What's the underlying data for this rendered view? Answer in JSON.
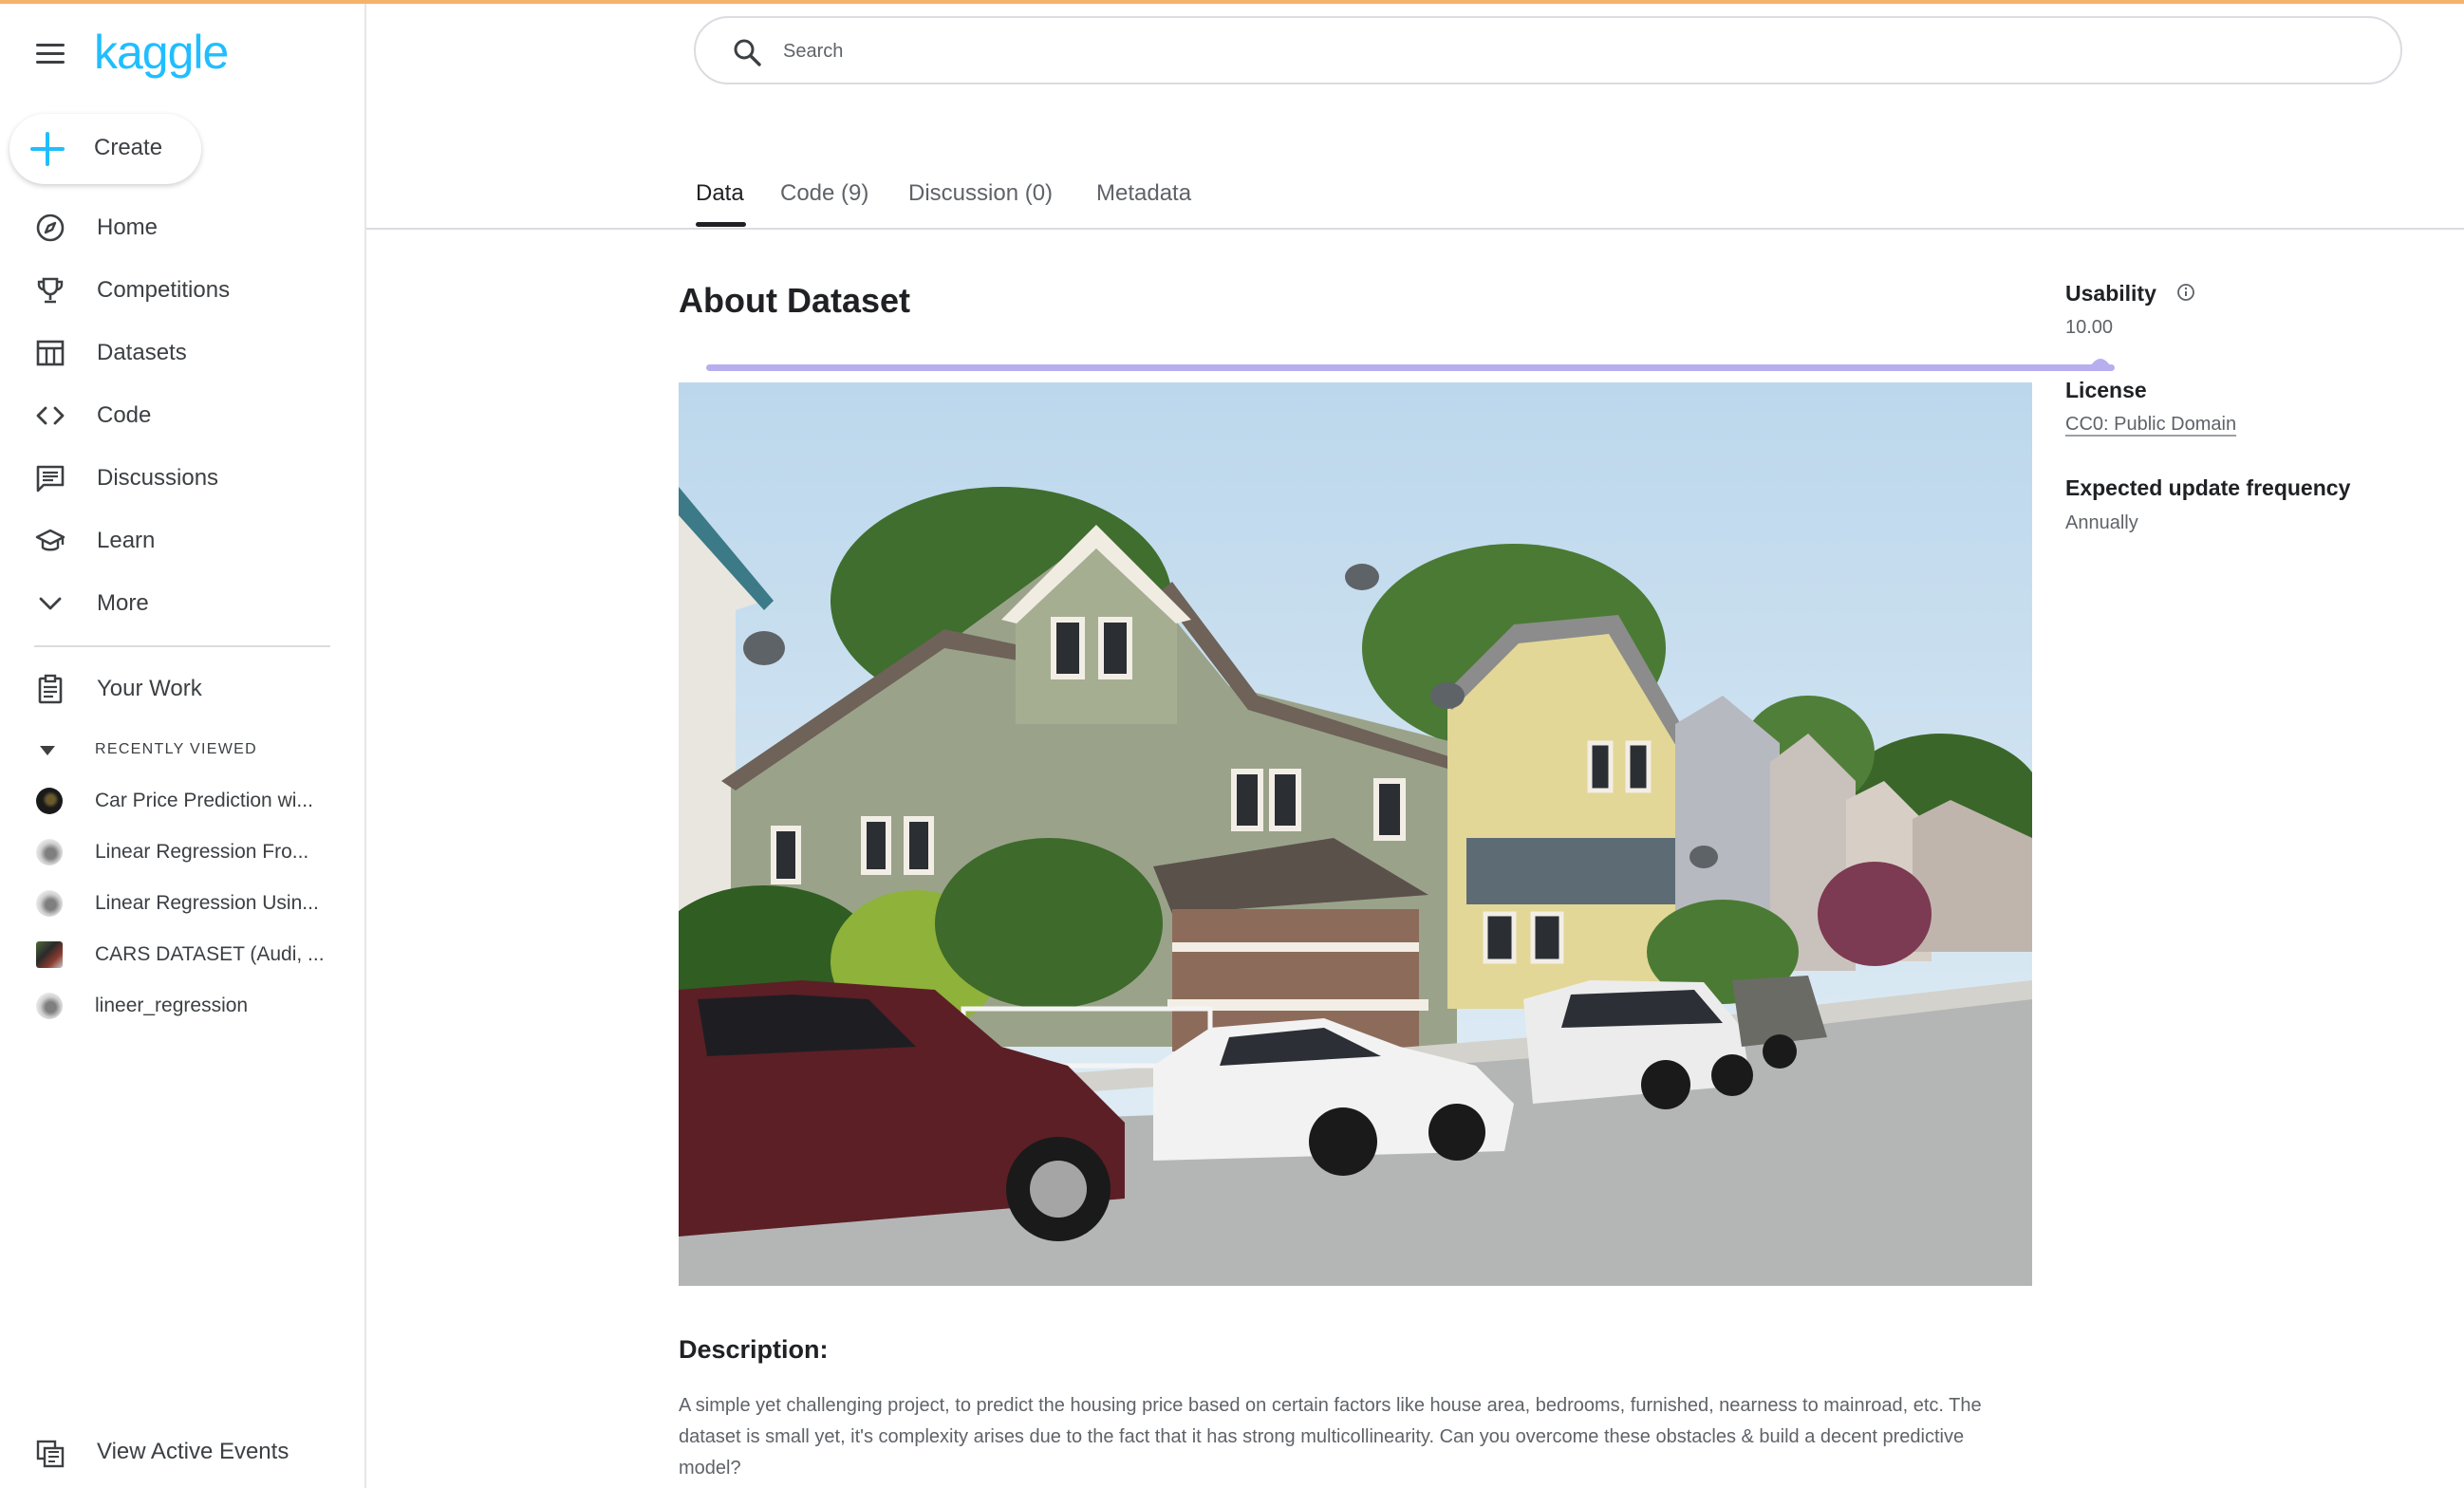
{
  "brand": {
    "logo_text": "kaggle",
    "accent_color": "#20beff",
    "top_bar_color": "#f4b26a"
  },
  "sidebar": {
    "create_label": "Create",
    "nav": [
      {
        "label": "Home",
        "icon": "compass-icon"
      },
      {
        "label": "Competitions",
        "icon": "trophy-icon"
      },
      {
        "label": "Datasets",
        "icon": "table-icon"
      },
      {
        "label": "Code",
        "icon": "code-brackets-icon"
      },
      {
        "label": "Discussions",
        "icon": "comment-icon"
      },
      {
        "label": "Learn",
        "icon": "graduation-cap-icon"
      },
      {
        "label": "More",
        "icon": "chevron-down-icon"
      }
    ],
    "your_work": {
      "label": "Your Work",
      "icon": "clipboard-icon"
    },
    "recently_viewed_heading": "RECENTLY VIEWED",
    "recently_viewed": [
      {
        "label": "Car Price Prediction wi..."
      },
      {
        "label": "Linear Regression Fro..."
      },
      {
        "label": "Linear Regression Usin..."
      },
      {
        "label": "CARS DATASET (Audi, ..."
      },
      {
        "label": "lineer_regression"
      }
    ],
    "events_label": "View Active Events"
  },
  "search": {
    "placeholder": "Search"
  },
  "tabs": [
    {
      "label": "Data",
      "active": true
    },
    {
      "label": "Code (9)",
      "active": false
    },
    {
      "label": "Discussion (0)",
      "active": false
    },
    {
      "label": "Metadata",
      "active": false
    }
  ],
  "main": {
    "title": "About Dataset",
    "usability_bar_color": "#b7aef0",
    "description_heading": "Description:",
    "description_text": "A simple yet challenging project, to predict the housing price based on certain factors like house area, bedrooms, furnished, nearness to mainroad, etc. The dataset is small yet, it's complexity arises due to the fact that it has strong multicollinearity. Can you overcome these obstacles & build a decent predictive model?"
  },
  "meta": {
    "usability_label": "Usability",
    "usability_value": "10.00",
    "license_label": "License",
    "license_value": "CC0: Public Domain",
    "update_label": "Expected update frequency",
    "update_value": "Annually"
  }
}
